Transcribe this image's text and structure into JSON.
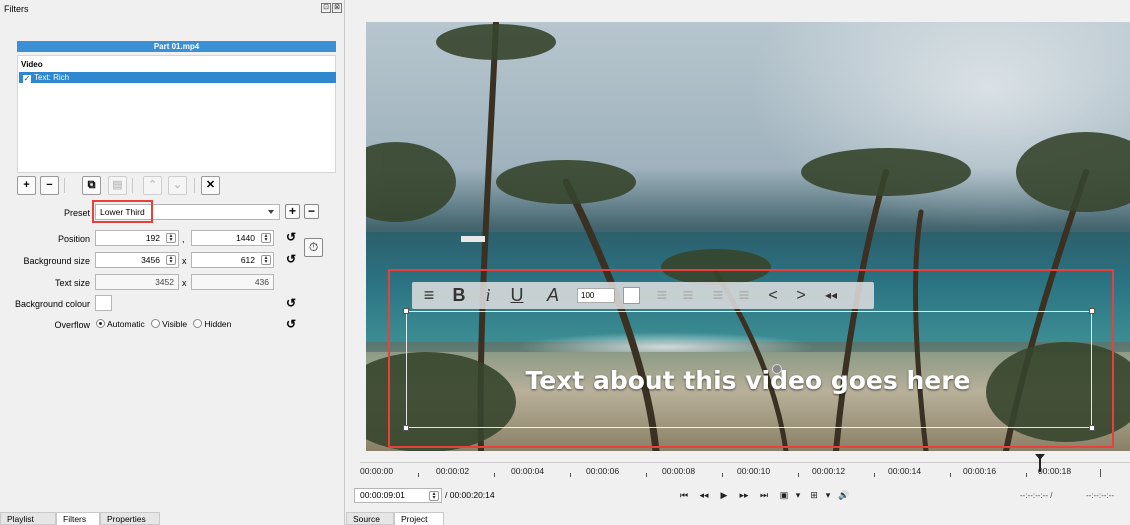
{
  "filters_panel": {
    "title": "Filters",
    "float_glyph": "⊡",
    "close_glyph": "⊠",
    "clip_name": "Part 01.mp4",
    "group_video": "Video",
    "filter_item": "Text: Rich",
    "check_glyph": "✓",
    "toolbar": {
      "add": "+",
      "remove": "−",
      "copy": "⧉",
      "paste": "▤",
      "up": "⌃",
      "down": "⌄",
      "deselect": "✕"
    },
    "preset_label": "Preset",
    "preset_value": "Lower Third",
    "position_label": "Position",
    "position_x": "192",
    "position_y": "1440",
    "bg_size_label": "Background size",
    "bg_size_w": "3456",
    "bg_size_h": "612",
    "text_size_label": "Text size",
    "text_size_w": "3452",
    "text_size_h": "436",
    "bg_colour_label": "Background colour",
    "overflow_label": "Overflow",
    "overflow_options": [
      "Automatic",
      "Visible",
      "Hidden"
    ],
    "overflow_selected": "Automatic",
    "comma": ",",
    "times": "x",
    "undo_glyph": "↺",
    "timer_glyph": "⏱"
  },
  "left_tabs": [
    "Playlist",
    "Filters",
    "Properties"
  ],
  "left_tab_active": "Filters",
  "text_toolbar": {
    "menu": "≡",
    "bold": "B",
    "italic": "i",
    "underline": "U",
    "font": "A",
    "font_size": "100",
    "align_left": "≡",
    "align_center": "≡",
    "align_right": "≡",
    "justify": "≡",
    "prev": "<",
    "next": ">",
    "rewind": "◂◂"
  },
  "overlay_text": "Text about this video goes here",
  "timeline": {
    "ticks": [
      "00:00:00",
      "00:00:02",
      "00:00:04",
      "00:00:06",
      "00:00:08",
      "00:00:10",
      "00:00:12",
      "00:00:14",
      "00:00:16",
      "00:00:18"
    ],
    "current_time": "00:00:09:01",
    "total_time": "/ 00:00:20:14",
    "in_point": "--:--:--:-- /",
    "out_point": "--:--:--:--"
  },
  "transport": [
    "⏮",
    "◂◂",
    "▶",
    "▸▸",
    "⏭",
    "▣",
    "▾",
    "⊞",
    "▾",
    "🔊"
  ],
  "right_tabs": [
    "Source",
    "Project"
  ],
  "right_tab_active": "Project",
  "colors": {
    "selection": "#2f87d0",
    "highlight_box": "#e8413d"
  }
}
